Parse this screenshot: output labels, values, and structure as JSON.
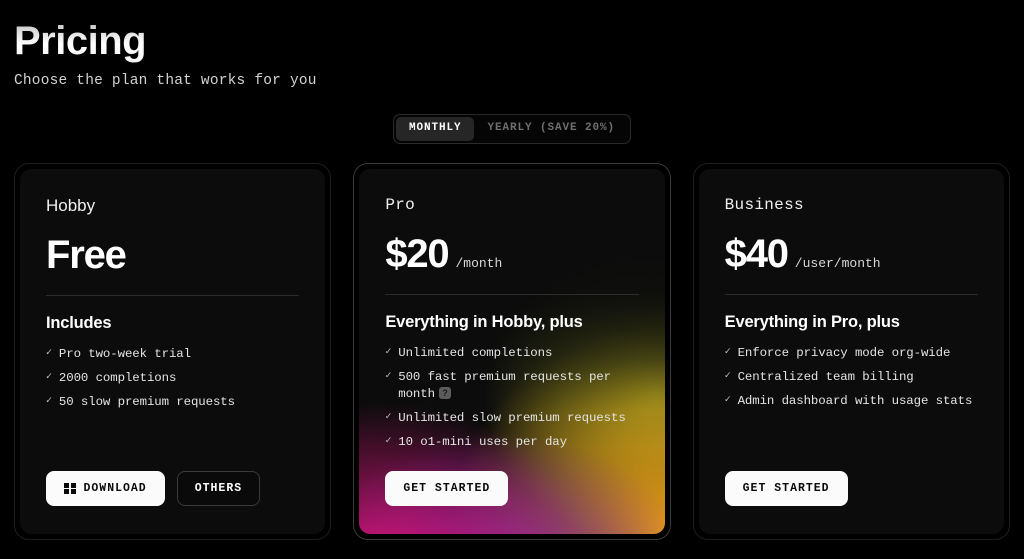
{
  "header": {
    "title": "Pricing",
    "subtitle": "Choose the plan that works for you"
  },
  "billing_toggle": {
    "monthly_label": "MONTHLY",
    "yearly_label": "YEARLY (SAVE 20%)",
    "selected": "MONTHLY"
  },
  "plans": [
    {
      "name": "Hobby",
      "price": "Free",
      "period": "",
      "includes_title": "Includes",
      "features": [
        {
          "text": "Pro two-week trial",
          "help": false
        },
        {
          "text": "2000 completions",
          "help": false
        },
        {
          "text": "50 slow premium requests",
          "help": false
        }
      ],
      "buttons": [
        {
          "label": "DOWNLOAD",
          "style": "light",
          "icon": "windows-icon"
        },
        {
          "label": "OTHERS",
          "style": "dark",
          "icon": ""
        }
      ]
    },
    {
      "name": "Pro",
      "price": "$20",
      "period": "/month",
      "includes_title": "Everything in Hobby, plus",
      "features": [
        {
          "text": "Unlimited completions",
          "help": false
        },
        {
          "text": "500 fast premium requests per month",
          "help": true,
          "help_glyph": "?"
        },
        {
          "text": "Unlimited slow premium requests",
          "help": false
        },
        {
          "text": "10 o1-mini uses per day",
          "help": false
        }
      ],
      "buttons": [
        {
          "label": "GET STARTED",
          "style": "light",
          "icon": ""
        }
      ]
    },
    {
      "name": "Business",
      "price": "$40",
      "period": "/user/month",
      "includes_title": "Everything in Pro, plus",
      "features": [
        {
          "text": "Enforce privacy mode org-wide",
          "help": false
        },
        {
          "text": "Centralized team billing",
          "help": false
        },
        {
          "text": "Admin dashboard with usage stats",
          "help": false
        }
      ],
      "buttons": [
        {
          "label": "GET STARTED",
          "style": "light",
          "icon": ""
        }
      ]
    }
  ],
  "icons": {
    "check": "✓"
  },
  "colors": {
    "background": "#000000",
    "card_background": "#0c0c0c",
    "card_border": "#1e1e1e",
    "featured_border": "#3a3a3a",
    "accent_magenta": "#e0157f",
    "accent_purple": "#8a2bc0",
    "accent_orange": "#f0a016",
    "accent_olive": "#9aa420",
    "text_primary": "#ffffff",
    "text_muted": "#6f6f6f"
  }
}
